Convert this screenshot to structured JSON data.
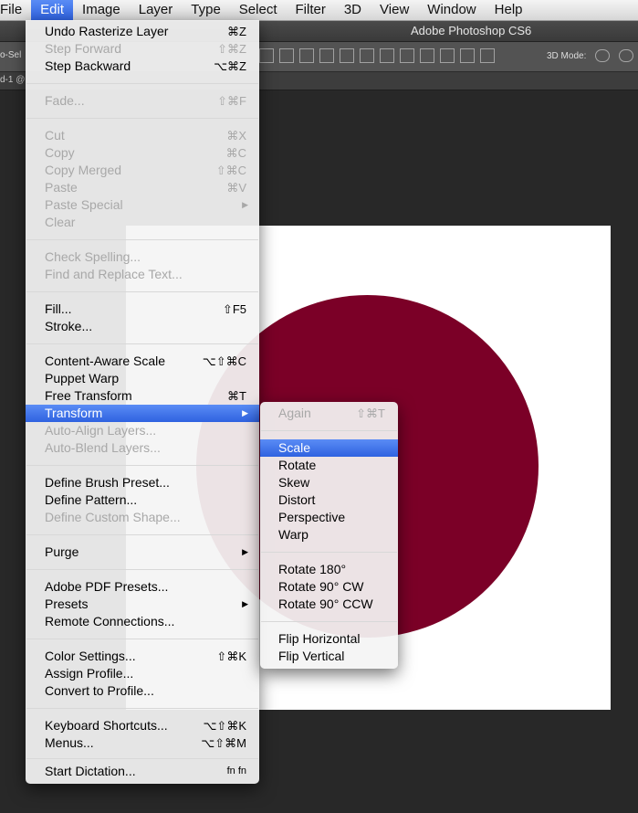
{
  "menubar": {
    "items": [
      "File",
      "Edit",
      "Image",
      "Layer",
      "Type",
      "Select",
      "Filter",
      "3D",
      "View",
      "Window",
      "Help"
    ]
  },
  "app_title": "Adobe Photoshop CS6",
  "optionsbar": {
    "auto_select": "o-Sel",
    "mode_3d": "3D Mode:"
  },
  "doc_tab": "d-1 @",
  "canvas": {
    "circle_color": "#7b0027",
    "background": "#ffffff"
  },
  "edit_menu": {
    "undo": "Undo Rasterize Layer",
    "undo_sc": "⌘Z",
    "step_forward": "Step Forward",
    "step_forward_sc": "⇧⌘Z",
    "step_backward": "Step Backward",
    "step_backward_sc": "⌥⌘Z",
    "fade": "Fade...",
    "fade_sc": "⇧⌘F",
    "cut": "Cut",
    "cut_sc": "⌘X",
    "copy": "Copy",
    "copy_sc": "⌘C",
    "copy_merged": "Copy Merged",
    "copy_merged_sc": "⇧⌘C",
    "paste": "Paste",
    "paste_sc": "⌘V",
    "paste_special": "Paste Special",
    "clear": "Clear",
    "check_spelling": "Check Spelling...",
    "find_replace": "Find and Replace Text...",
    "fill": "Fill...",
    "fill_sc": "⇧F5",
    "stroke": "Stroke...",
    "content_aware_scale": "Content-Aware Scale",
    "content_aware_scale_sc": "⌥⇧⌘C",
    "puppet_warp": "Puppet Warp",
    "free_transform": "Free Transform",
    "free_transform_sc": "⌘T",
    "transform": "Transform",
    "auto_align": "Auto-Align Layers...",
    "auto_blend": "Auto-Blend Layers...",
    "define_brush": "Define Brush Preset...",
    "define_pattern": "Define Pattern...",
    "define_custom_shape": "Define Custom Shape...",
    "purge": "Purge",
    "pdf_presets": "Adobe PDF Presets...",
    "presets": "Presets",
    "remote_connections": "Remote Connections...",
    "color_settings": "Color Settings...",
    "color_settings_sc": "⇧⌘K",
    "assign_profile": "Assign Profile...",
    "convert_profile": "Convert to Profile...",
    "keyboard_shortcuts": "Keyboard Shortcuts...",
    "keyboard_shortcuts_sc": "⌥⇧⌘K",
    "menus": "Menus...",
    "menus_sc": "⌥⇧⌘M",
    "start_dictation": "Start Dictation...",
    "start_dictation_sc": "fn fn"
  },
  "transform_menu": {
    "again": "Again",
    "again_sc": "⇧⌘T",
    "scale": "Scale",
    "rotate": "Rotate",
    "skew": "Skew",
    "distort": "Distort",
    "perspective": "Perspective",
    "warp": "Warp",
    "rotate_180": "Rotate 180°",
    "rotate_90_cw": "Rotate 90° CW",
    "rotate_90_ccw": "Rotate 90° CCW",
    "flip_h": "Flip Horizontal",
    "flip_v": "Flip Vertical"
  }
}
